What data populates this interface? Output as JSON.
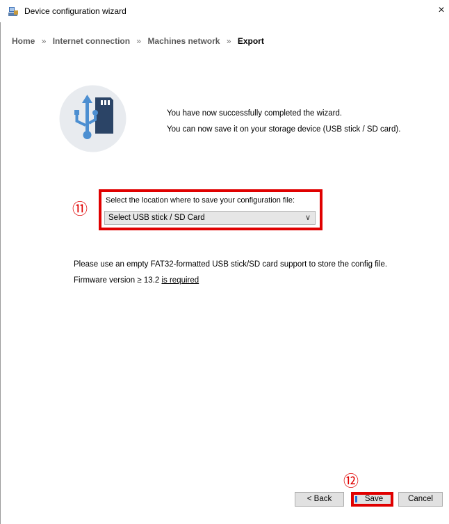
{
  "window": {
    "title": "Device configuration wizard",
    "close_glyph": "×"
  },
  "breadcrumb": {
    "items": [
      "Home",
      "Internet connection",
      "Machines network",
      "Export"
    ],
    "separator": "»"
  },
  "hero": {
    "icon": "usb-sd-card-icon"
  },
  "success": {
    "line1": "You have now successfully completed the wizard.",
    "line2": "You can now save it on your storage device (USB stick / SD card)."
  },
  "location": {
    "label": "Select the location where to save your configuration file:",
    "selected": "Select USB stick / SD Card"
  },
  "annotations": {
    "step11": "⑪",
    "step12": "⑫",
    "highlight_color": "#e00000"
  },
  "info": {
    "line1": "Please use an empty FAT32-formatted USB stick/SD card support to store the config file.",
    "firmware_prefix": "Firmware version ≥ 13.2 ",
    "firmware_link": "is required"
  },
  "buttons": {
    "back": "< Back",
    "save": "Save",
    "cancel": "Cancel"
  }
}
